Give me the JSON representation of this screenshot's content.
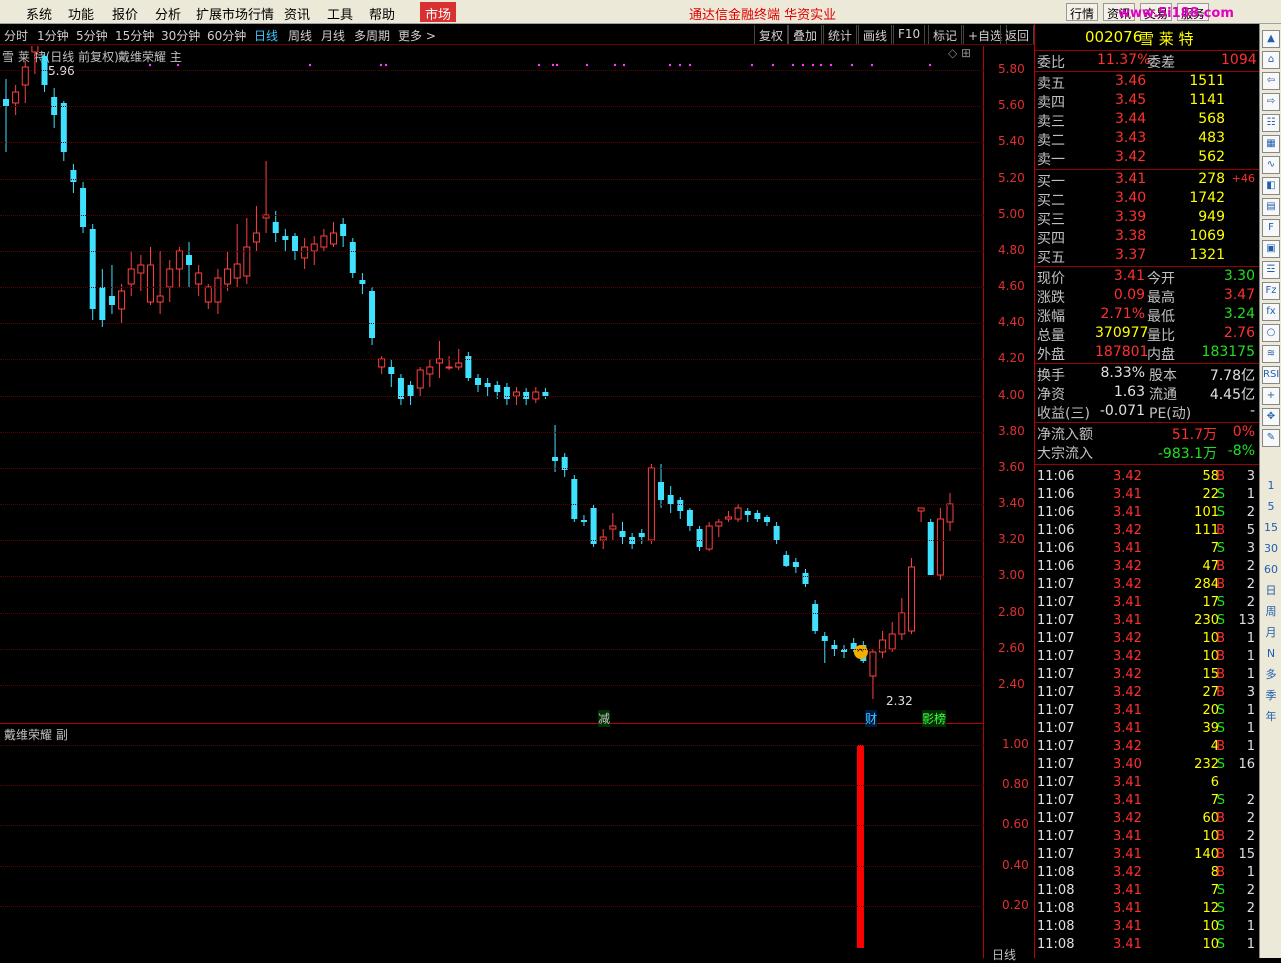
{
  "menu": {
    "items": [
      "系统",
      "功能",
      "报价",
      "分析",
      "扩展市场行情",
      "资讯",
      "工具",
      "帮助"
    ],
    "active": "市场"
  },
  "promo": "通达信金融终端 华资实业",
  "right_tabs": [
    "行情",
    "资讯",
    "交易",
    "服务"
  ],
  "watermark": "www.5i188.com",
  "toolbar": {
    "periods": [
      "分时",
      "1分钟",
      "5分钟",
      "15分钟",
      "30分钟",
      "60分钟",
      "日线",
      "周线",
      "月线",
      "多周期",
      "更多 >"
    ],
    "active": "日线",
    "buttons": [
      "复权",
      "叠加",
      "统计",
      "画线",
      "F10",
      "标记",
      "+自选",
      "返回"
    ]
  },
  "main_chart": {
    "title": "雪 莱 特(日线 前复权)",
    "indicator": "戴维荣耀 主",
    "high_label": "5.96",
    "low_label": "2.32",
    "y_labels": [
      "5.80",
      "5.60",
      "5.40",
      "5.20",
      "5.00",
      "4.80",
      "4.60",
      "4.40",
      "4.20",
      "4.00",
      "3.80",
      "3.60",
      "3.40",
      "3.20",
      "3.00",
      "2.80",
      "2.60",
      "2.40"
    ],
    "markers": [
      {
        "text": "减",
        "color": "#40ff40"
      },
      {
        "text": "财",
        "color": "#40c8ff"
      },
      {
        "text": "影榜",
        "color": "#40ff40"
      }
    ]
  },
  "sub_chart": {
    "title": "戴维荣耀 副",
    "y_labels": [
      "1.00",
      "0.80",
      "0.60",
      "0.40",
      "0.20"
    ],
    "bar_value": 1.0,
    "corner": "日线"
  },
  "chart_data": {
    "type": "candlestick",
    "ylim": [
      2.25,
      6.0
    ],
    "candles": [
      [
        5.64,
        5.6,
        5.75,
        5.35
      ],
      [
        5.62,
        5.68,
        5.72,
        5.55
      ],
      [
        5.72,
        5.82,
        5.85,
        5.62
      ],
      [
        5.9,
        5.95,
        5.96,
        5.78
      ],
      [
        5.88,
        5.72,
        5.9,
        5.68
      ],
      [
        5.65,
        5.55,
        5.7,
        5.48
      ],
      [
        5.62,
        5.35,
        5.63,
        5.3
      ],
      [
        5.25,
        5.18,
        5.28,
        5.12
      ],
      [
        5.15,
        4.93,
        5.18,
        4.9
      ],
      [
        4.92,
        4.48,
        4.95,
        4.42
      ],
      [
        4.6,
        4.42,
        4.7,
        4.38
      ],
      [
        4.55,
        4.5,
        4.72,
        4.45
      ],
      [
        4.48,
        4.58,
        4.62,
        4.4
      ],
      [
        4.62,
        4.7,
        4.8,
        4.55
      ],
      [
        4.68,
        4.72,
        4.78,
        4.58
      ],
      [
        4.52,
        4.72,
        4.82,
        4.5
      ],
      [
        4.52,
        4.55,
        4.8,
        4.45
      ],
      [
        4.6,
        4.7,
        4.75,
        4.52
      ],
      [
        4.7,
        4.8,
        4.82,
        4.6
      ],
      [
        4.78,
        4.72,
        4.85,
        4.6
      ],
      [
        4.62,
        4.68,
        4.72,
        4.55
      ],
      [
        4.52,
        4.6,
        4.62,
        4.48
      ],
      [
        4.52,
        4.65,
        4.7,
        4.45
      ],
      [
        4.62,
        4.7,
        4.8,
        4.58
      ],
      [
        4.65,
        4.73,
        4.95,
        4.6
      ],
      [
        4.66,
        4.82,
        4.98,
        4.62
      ],
      [
        4.85,
        4.9,
        5.05,
        4.8
      ],
      [
        4.98,
        5.0,
        5.3,
        4.9
      ],
      [
        4.96,
        4.9,
        5.02,
        4.85
      ],
      [
        4.88,
        4.86,
        4.92,
        4.8
      ],
      [
        4.88,
        4.8,
        4.9,
        4.75
      ],
      [
        4.76,
        4.82,
        4.87,
        4.7
      ],
      [
        4.8,
        4.84,
        4.88,
        4.72
      ],
      [
        4.82,
        4.88,
        4.92,
        4.8
      ],
      [
        4.84,
        4.9,
        4.96,
        4.82
      ],
      [
        4.95,
        4.88,
        4.98,
        4.82
      ],
      [
        4.85,
        4.68,
        4.87,
        4.65
      ],
      [
        4.64,
        4.62,
        4.68,
        4.56
      ],
      [
        4.58,
        4.32,
        4.6,
        4.28
      ],
      [
        4.16,
        4.2,
        4.22,
        4.12
      ],
      [
        4.16,
        4.12,
        4.2,
        4.05
      ],
      [
        4.1,
        3.98,
        4.12,
        3.95
      ],
      [
        4.06,
        4.0,
        4.08,
        3.95
      ],
      [
        4.04,
        4.14,
        4.16,
        4.0
      ],
      [
        4.12,
        4.16,
        4.2,
        4.05
      ],
      [
        4.18,
        4.2,
        4.3,
        4.1
      ],
      [
        4.16,
        4.16,
        4.22,
        4.14
      ],
      [
        4.16,
        4.18,
        4.26,
        4.14
      ],
      [
        4.22,
        4.1,
        4.24,
        4.08
      ],
      [
        4.1,
        4.06,
        4.12,
        4.02
      ],
      [
        4.07,
        4.05,
        4.1,
        4.0
      ],
      [
        4.06,
        4.02,
        4.08,
        3.98
      ],
      [
        4.05,
        3.98,
        4.07,
        3.95
      ],
      [
        4.0,
        4.02,
        4.05,
        3.95
      ],
      [
        4.02,
        3.98,
        4.04,
        3.95
      ],
      [
        3.98,
        4.02,
        4.05,
        3.96
      ],
      [
        4.02,
        4.0,
        4.04,
        3.98
      ],
      [
        3.66,
        3.64,
        3.84,
        3.58
      ],
      [
        3.66,
        3.59,
        3.68,
        3.55
      ],
      [
        3.54,
        3.32,
        3.56,
        3.3
      ],
      [
        3.31,
        3.3,
        3.34,
        3.28
      ],
      [
        3.38,
        3.18,
        3.4,
        3.16
      ],
      [
        3.2,
        3.22,
        3.26,
        3.15
      ],
      [
        3.26,
        3.28,
        3.35,
        3.2
      ],
      [
        3.25,
        3.22,
        3.3,
        3.18
      ],
      [
        3.22,
        3.18,
        3.24,
        3.15
      ],
      [
        3.24,
        3.22,
        3.26,
        3.18
      ],
      [
        3.2,
        3.6,
        3.62,
        3.18
      ],
      [
        3.52,
        3.42,
        3.62,
        3.38
      ],
      [
        3.45,
        3.4,
        3.5,
        3.35
      ],
      [
        3.42,
        3.36,
        3.44,
        3.32
      ],
      [
        3.37,
        3.28,
        3.38,
        3.25
      ],
      [
        3.26,
        3.16,
        3.28,
        3.14
      ],
      [
        3.15,
        3.28,
        3.3,
        3.14
      ],
      [
        3.28,
        3.3,
        3.32,
        3.22
      ],
      [
        3.32,
        3.33,
        3.36,
        3.3
      ],
      [
        3.32,
        3.38,
        3.4,
        3.3
      ],
      [
        3.36,
        3.34,
        3.38,
        3.3
      ],
      [
        3.35,
        3.32,
        3.37,
        3.3
      ],
      [
        3.33,
        3.3,
        3.34,
        3.28
      ],
      [
        3.28,
        3.2,
        3.3,
        3.18
      ],
      [
        3.12,
        3.06,
        3.14,
        3.05
      ],
      [
        3.08,
        3.05,
        3.1,
        3.02
      ],
      [
        3.02,
        2.96,
        3.04,
        2.94
      ],
      [
        2.85,
        2.7,
        2.87,
        2.68
      ],
      [
        2.67,
        2.64,
        2.69,
        2.52
      ],
      [
        2.62,
        2.6,
        2.65,
        2.56
      ],
      [
        2.6,
        2.58,
        2.62,
        2.55
      ],
      [
        2.63,
        2.6,
        2.66,
        2.58
      ],
      [
        2.62,
        2.53,
        2.64,
        2.52
      ],
      [
        2.45,
        2.58,
        2.6,
        2.32
      ],
      [
        2.58,
        2.65,
        2.7,
        2.55
      ],
      [
        2.6,
        2.68,
        2.75,
        2.58
      ],
      [
        2.68,
        2.8,
        2.88,
        2.65
      ],
      [
        2.7,
        3.05,
        3.1,
        2.68
      ],
      [
        3.36,
        3.38,
        3.38,
        3.3
      ],
      [
        3.3,
        3.01,
        3.32,
        3.01
      ],
      [
        3.01,
        3.32,
        3.38,
        2.98
      ],
      [
        3.3,
        3.4,
        3.46,
        3.25
      ]
    ],
    "signal_marker_index": 90
  },
  "quote": {
    "code": "002076",
    "name": "雪 莱 特",
    "weibi": {
      "label": "委比",
      "value": "11.37%",
      "diff_label": "委差",
      "diff": "1094"
    },
    "sells": [
      {
        "label": "卖五",
        "price": "3.46",
        "vol": "1511"
      },
      {
        "label": "卖四",
        "price": "3.45",
        "vol": "1141"
      },
      {
        "label": "卖三",
        "price": "3.44",
        "vol": "568"
      },
      {
        "label": "卖二",
        "price": "3.43",
        "vol": "483"
      },
      {
        "label": "卖一",
        "price": "3.42",
        "vol": "562"
      }
    ],
    "buys": [
      {
        "label": "买一",
        "price": "3.41",
        "vol": "278",
        "chg": "+46"
      },
      {
        "label": "买二",
        "price": "3.40",
        "vol": "1742",
        "chg": ""
      },
      {
        "label": "买三",
        "price": "3.39",
        "vol": "949",
        "chg": ""
      },
      {
        "label": "买四",
        "price": "3.38",
        "vol": "1069",
        "chg": ""
      },
      {
        "label": "买五",
        "price": "3.37",
        "vol": "1321",
        "chg": ""
      }
    ],
    "stats": [
      {
        "l1": "现价",
        "v1": "3.41",
        "c1": "red",
        "l2": "今开",
        "v2": "3.30",
        "c2": "grn"
      },
      {
        "l1": "涨跌",
        "v1": "0.09",
        "c1": "red",
        "l2": "最高",
        "v2": "3.47",
        "c2": "red"
      },
      {
        "l1": "涨幅",
        "v1": "2.71%",
        "c1": "red",
        "l2": "最低",
        "v2": "3.24",
        "c2": "grn"
      },
      {
        "l1": "总量",
        "v1": "370977",
        "c1": "yel",
        "l2": "量比",
        "v2": "2.76",
        "c2": "red"
      },
      {
        "l1": "外盘",
        "v1": "187801",
        "c1": "red",
        "l2": "内盘",
        "v2": "183175",
        "c2": "grn"
      }
    ],
    "stats2": [
      {
        "l1": "换手",
        "v1": "8.33%",
        "l2": "股本",
        "v2": "7.78亿"
      },
      {
        "l1": "净资",
        "v1": "1.63",
        "l2": "流通",
        "v2": "4.45亿"
      },
      {
        "l1": "收益(三)",
        "v1": "-0.071",
        "l2": "PE(动)",
        "v2": "-"
      }
    ],
    "flow": [
      {
        "label": "净流入额",
        "value": "51.7万",
        "pct": "0%",
        "c": "red"
      },
      {
        "label": "大宗流入",
        "value": "-983.1万",
        "pct": "-8%",
        "c": "grn"
      }
    ]
  },
  "ticks": [
    [
      "11:06",
      "3.42",
      "58",
      "B",
      "3"
    ],
    [
      "11:06",
      "3.41",
      "22",
      "S",
      "1"
    ],
    [
      "11:06",
      "3.41",
      "101",
      "S",
      "2"
    ],
    [
      "11:06",
      "3.42",
      "111",
      "B",
      "5"
    ],
    [
      "11:06",
      "3.41",
      "7",
      "S",
      "3"
    ],
    [
      "11:06",
      "3.42",
      "47",
      "B",
      "2"
    ],
    [
      "11:07",
      "3.42",
      "284",
      "B",
      "2"
    ],
    [
      "11:07",
      "3.41",
      "17",
      "S",
      "2"
    ],
    [
      "11:07",
      "3.41",
      "230",
      "S",
      "13"
    ],
    [
      "11:07",
      "3.42",
      "10",
      "B",
      "1"
    ],
    [
      "11:07",
      "3.42",
      "10",
      "B",
      "1"
    ],
    [
      "11:07",
      "3.42",
      "15",
      "B",
      "1"
    ],
    [
      "11:07",
      "3.42",
      "27",
      "B",
      "3"
    ],
    [
      "11:07",
      "3.41",
      "20",
      "S",
      "1"
    ],
    [
      "11:07",
      "3.41",
      "39",
      "S",
      "1"
    ],
    [
      "11:07",
      "3.42",
      "4",
      "B",
      "1"
    ],
    [
      "11:07",
      "3.40",
      "232",
      "S",
      "16"
    ],
    [
      "11:07",
      "3.41",
      "6",
      "",
      ""
    ],
    [
      "11:07",
      "3.41",
      "7",
      "S",
      "2"
    ],
    [
      "11:07",
      "3.42",
      "60",
      "B",
      "2"
    ],
    [
      "11:07",
      "3.41",
      "10",
      "B",
      "2"
    ],
    [
      "11:07",
      "3.41",
      "140",
      "B",
      "15"
    ],
    [
      "11:08",
      "3.42",
      "8",
      "B",
      "1"
    ],
    [
      "11:08",
      "3.41",
      "7",
      "S",
      "2"
    ],
    [
      "11:08",
      "3.41",
      "12",
      "S",
      "2"
    ],
    [
      "11:08",
      "3.41",
      "10",
      "S",
      "1"
    ],
    [
      "11:08",
      "3.41",
      "10",
      "S",
      "1"
    ]
  ],
  "sidebar_icons": [
    "up-arrow-icon",
    "home-icon",
    "back-icon",
    "forward-icon",
    "list-icon",
    "table-icon",
    "line-chart-icon",
    "kline-icon",
    "grid-icon",
    "f10-icon",
    "doc-icon",
    "calendar-icon",
    "fiz-icon",
    "fx-icon",
    "circle-icon",
    "chart-icon",
    "rsi-icon",
    "plus-icon",
    "move-icon",
    "pen-icon"
  ],
  "sidebar_periods": [
    "1",
    "5",
    "15",
    "30",
    "60",
    "日",
    "周",
    "月",
    "N",
    "多",
    "季",
    "年"
  ]
}
